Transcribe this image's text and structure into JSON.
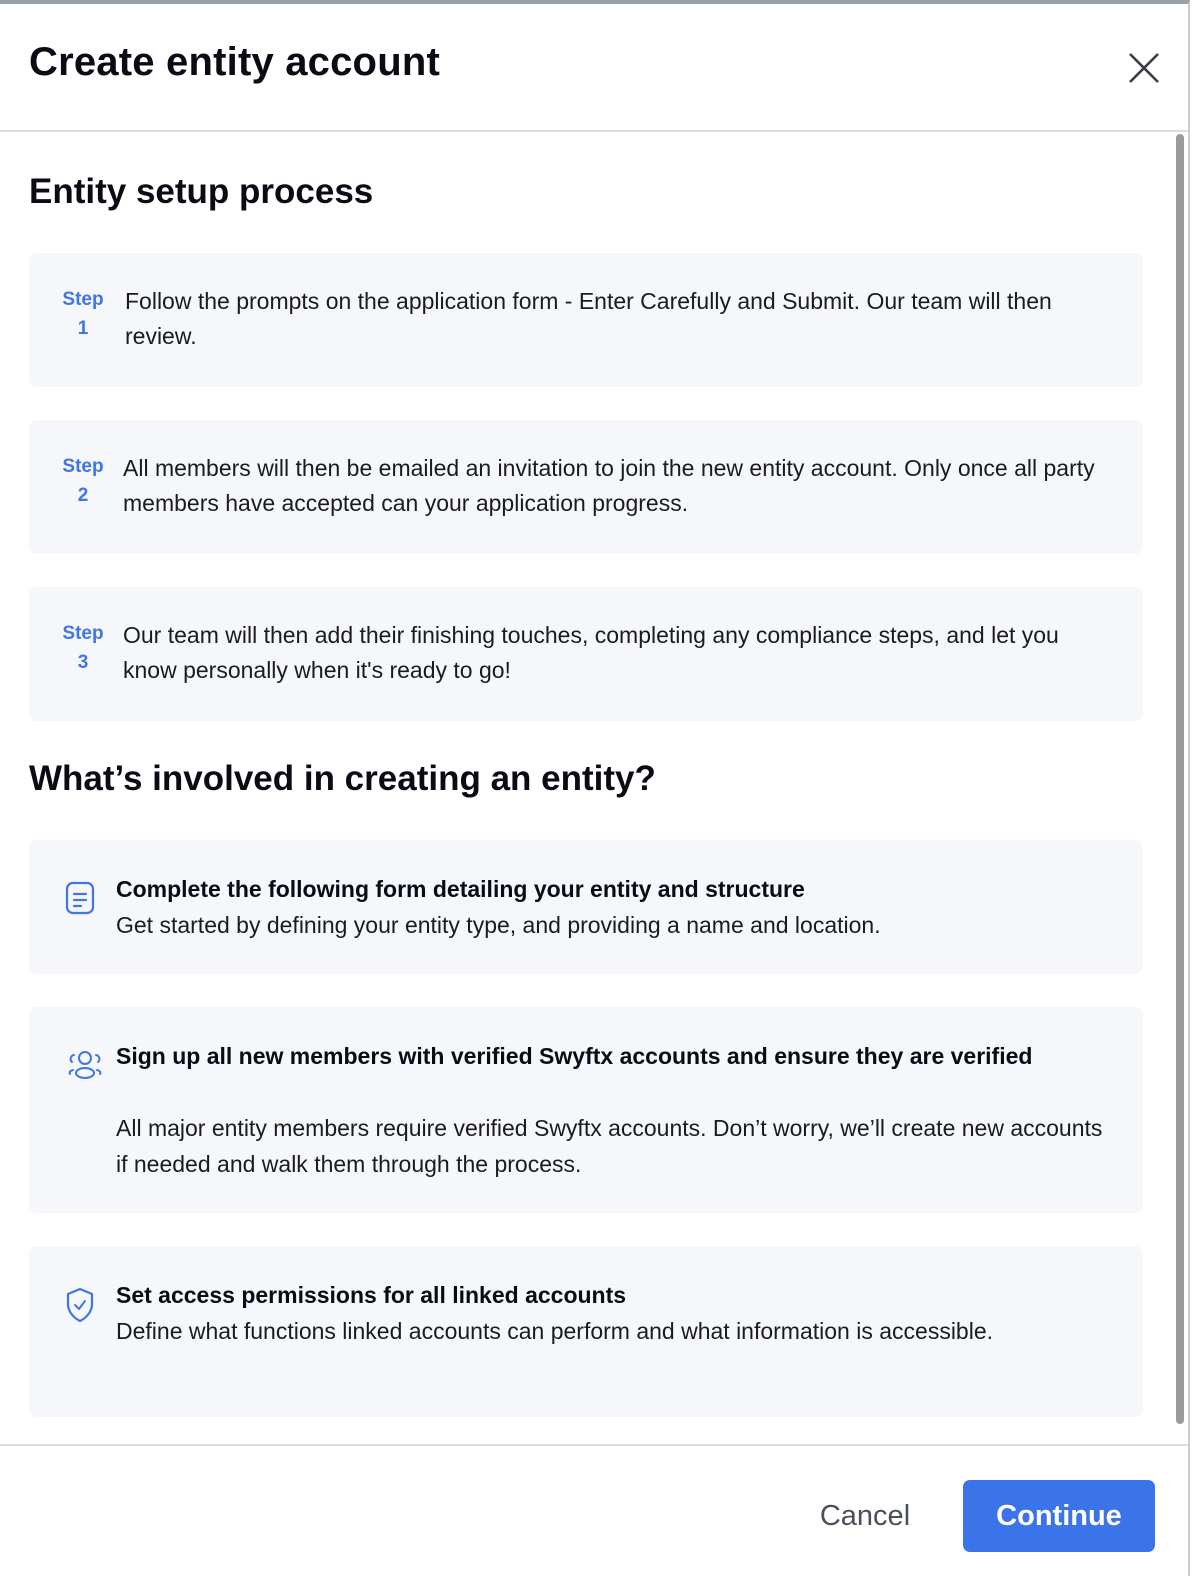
{
  "modal": {
    "title": "Create entity account",
    "close_icon": "close-icon"
  },
  "setup": {
    "heading": "Entity setup process",
    "steps": [
      {
        "label": "Step",
        "number": "1",
        "text": "Follow the prompts on the application form - Enter Carefully and Submit. Our team will then review."
      },
      {
        "label": "Step",
        "number": "2",
        "text": "All members will then be emailed an invitation to join the new entity account. Only once all party members have accepted can your application progress."
      },
      {
        "label": "Step",
        "number": "3",
        "text": "Our team will then add their finishing touches, completing any compliance steps, and let you know personally when it's ready to go!"
      }
    ]
  },
  "involved": {
    "heading": "What’s involved in creating an entity?",
    "items": [
      {
        "icon": "document-icon",
        "title": "Complete the following form detailing your entity and structure",
        "description": "Get started by defining your entity type, and providing a name and location."
      },
      {
        "icon": "members-icon",
        "title": "Sign up all new members with verified Swyftx accounts and ensure they are verified",
        "description": "All major entity members require verified Swyftx accounts. Don’t worry, we’ll create new accounts if needed and walk them through the process."
      },
      {
        "icon": "shield-check-icon",
        "title": "Set access permissions for all linked accounts",
        "description": "Define what functions linked accounts can perform and what information is accessible."
      }
    ]
  },
  "footer": {
    "cancel_label": "Cancel",
    "continue_label": "Continue"
  },
  "colors": {
    "accent": "#3b74e8",
    "step_label": "#3f76e4",
    "card_background": "#f6f7fa"
  }
}
